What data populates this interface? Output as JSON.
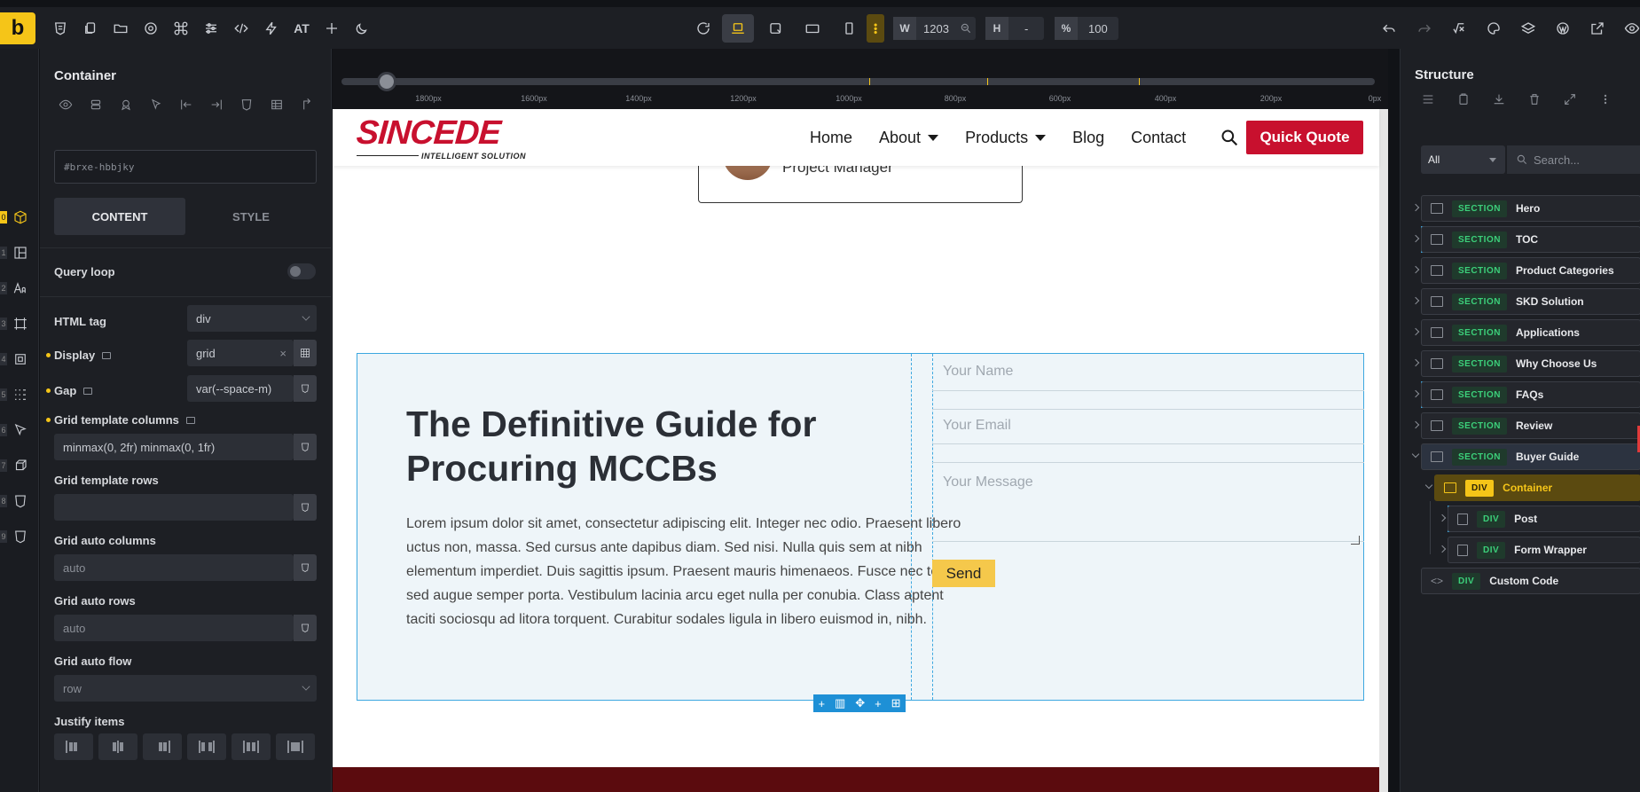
{
  "topbar": {
    "logo": "b",
    "at_label": "AT",
    "width_label": "W",
    "width_value": "1203",
    "height_label": "H",
    "height_value": "-",
    "zoom_label": "%",
    "zoom_value": "100",
    "accent": "#f5c518"
  },
  "leftbar": {
    "items": [
      {
        "num": "0",
        "icon": "box-icon"
      },
      {
        "num": "1",
        "icon": "layout-icon"
      },
      {
        "num": "2",
        "icon": "typography-icon"
      },
      {
        "num": "3",
        "icon": "frame-icon"
      },
      {
        "num": "4",
        "icon": "crop-icon"
      },
      {
        "num": "5",
        "icon": "grid-dots-icon"
      },
      {
        "num": "6",
        "icon": "cursor-icon"
      },
      {
        "num": "7",
        "icon": "cube-icon"
      },
      {
        "num": "8",
        "icon": "shield-icon"
      },
      {
        "num": "9",
        "icon": "shield-icon"
      }
    ]
  },
  "panel": {
    "title": "Container",
    "element_id": "#brxe-hbbjky",
    "tab_content": "CONTENT",
    "tab_style": "STYLE",
    "query_loop": "Query loop",
    "html_tag_label": "HTML tag",
    "html_tag_value": "div",
    "display_label": "Display",
    "display_value": "grid",
    "display_clear": "×",
    "gap_label": "Gap",
    "gap_value": "var(--space-m)",
    "gtc_label": "Grid template columns",
    "gtc_value": "minmax(0, 2fr) minmax(0, 1fr)",
    "gtr_label": "Grid template rows",
    "gtr_value": "",
    "gac_label": "Grid auto columns",
    "gac_value": "auto",
    "gar_label": "Grid auto rows",
    "gar_value": "auto",
    "gaf_label": "Grid auto flow",
    "gaf_value": "row",
    "justify_label": "Justify items"
  },
  "ruler": {
    "labels": [
      "1800px",
      "1600px",
      "1400px",
      "1200px",
      "1000px",
      "800px",
      "600px",
      "400px",
      "200px",
      "0px"
    ]
  },
  "site": {
    "brand": "SINCEDE",
    "tagline": "INTELLIGENT SOLUTION",
    "nav": [
      "Home",
      "About",
      "Products",
      "Blog",
      "Contact"
    ],
    "quote_button": "Quick Quote",
    "brand_color": "#c8102e",
    "role": "Project Manager",
    "guide_title": "The Definitive Guide for Procuring MCCBs",
    "guide_body": "Lorem ipsum dolor sit amet, consectetur adipiscing elit. Integer nec odio. Praesent libero uctus non, massa. Sed cursus ante dapibus diam. Sed nisi. Nulla quis sem at nibh elementum imperdiet. Duis sagittis ipsum. Praesent mauris himenaeos. Fusce nec tellus sed augue semper porta. Vestibulum lacinia arcu eget nulla per conubia. Class aptent taciti sociosqu ad litora torquent. Curabitur sodales ligula in libero euismod in, nibh.",
    "form_name": "Your Name",
    "form_email": "Your Email",
    "form_message": "Your Message",
    "send": "Send"
  },
  "structure": {
    "title": "Structure",
    "filter": "All",
    "search_placeholder": "Search...",
    "section_badge": "SECTION",
    "div_badge": "DIV",
    "sections": [
      "Hero",
      "TOC",
      "Product Categories",
      "SKD Solution",
      "Applications",
      "Why Choose Us",
      "FAQs",
      "Review",
      "Buyer Guide"
    ],
    "children": [
      "Container",
      "Post",
      "Form Wrapper"
    ],
    "custom_code": "Custom Code"
  }
}
